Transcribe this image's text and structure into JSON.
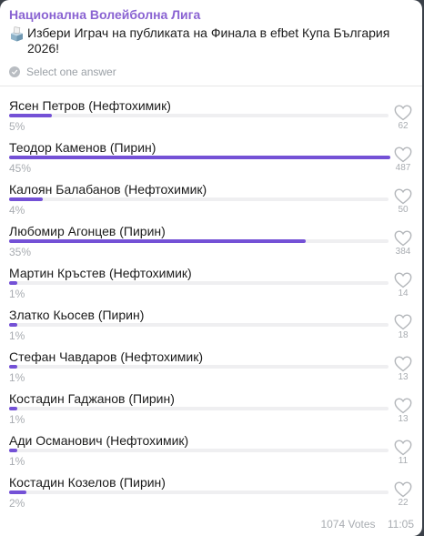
{
  "channel": "Национална Волейболна Лига",
  "question": {
    "icon": "ballot-box-icon",
    "text": "Избери Играч на публиката на Финала в efbet Купа България 2026!"
  },
  "instruction": "Select one answer",
  "options": [
    {
      "label": "Ясен Петров (Нефтохимик)",
      "percent_label": "5%",
      "percent": 5,
      "votes": "62"
    },
    {
      "label": "Теодор Каменов (Пирин)",
      "percent_label": "45%",
      "percent": 45,
      "votes": "487"
    },
    {
      "label": "Калоян Балабанов (Нефтохимик)",
      "percent_label": "4%",
      "percent": 4,
      "votes": "50"
    },
    {
      "label": "Любомир Агонцев (Пирин)",
      "percent_label": "35%",
      "percent": 35,
      "votes": "384"
    },
    {
      "label": "Мартин Кръстев (Нефтохимик)",
      "percent_label": "1%",
      "percent": 1,
      "votes": "14"
    },
    {
      "label": "Златко Кьосев (Пирин)",
      "percent_label": "1%",
      "percent": 1,
      "votes": "18"
    },
    {
      "label": "Стефан Чавдаров (Нефтохимик)",
      "percent_label": "1%",
      "percent": 1,
      "votes": "13"
    },
    {
      "label": "Костадин Гаджанов (Пирин)",
      "percent_label": "1%",
      "percent": 1,
      "votes": "13"
    },
    {
      "label": "Ади Османович (Нефтохимик)",
      "percent_label": "1%",
      "percent": 1,
      "votes": "11"
    },
    {
      "label": "Костадин Козелов (Пирин)",
      "percent_label": "2%",
      "percent": 2,
      "votes": "22"
    }
  ],
  "footer": {
    "total_votes": "1074 Votes",
    "time": "11:05"
  },
  "colors": {
    "accent": "#7451d6",
    "channel": "#8a63d2",
    "muted": "#a8acb1"
  }
}
